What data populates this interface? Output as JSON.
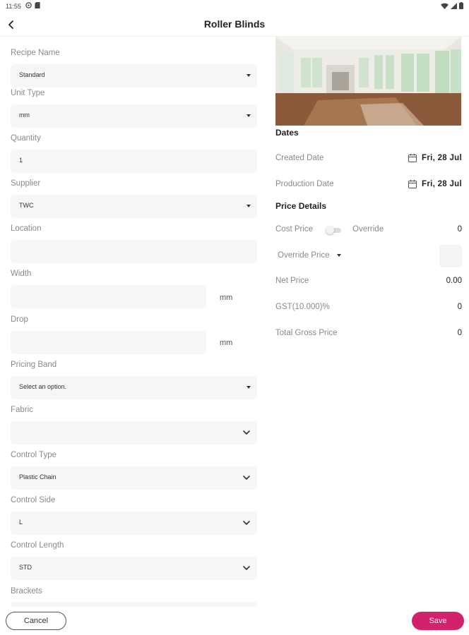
{
  "status_bar": {
    "time": "11:55",
    "icons": [
      "sync-icon",
      "sd-card-icon",
      "wifi-icon",
      "signal-icon",
      "battery-icon"
    ]
  },
  "app_bar": {
    "title": "Roller Blinds",
    "back_icon": "chevron-left-icon"
  },
  "form": {
    "recipe_name": {
      "label": "Recipe Name",
      "value": "Standard"
    },
    "unit_type": {
      "label": "Unit Type",
      "value": "mm"
    },
    "quantity": {
      "label": "Quantity",
      "value": "1"
    },
    "supplier": {
      "label": "Supplier",
      "value": "TWC"
    },
    "location": {
      "label": "Location",
      "value": ""
    },
    "width": {
      "label": "Width",
      "value": "",
      "unit": "mm"
    },
    "drop": {
      "label": "Drop",
      "value": "",
      "unit": "mm"
    },
    "pricing_band": {
      "label": "Pricing Band",
      "value": "Select an option."
    },
    "fabric": {
      "label": "Fabric",
      "value": ""
    },
    "control_type": {
      "label": "Control Type",
      "value": "Plastic Chain"
    },
    "control_side": {
      "label": "Control Side",
      "value": "L"
    },
    "control_length": {
      "label": "Control Length",
      "value": "STD"
    },
    "brackets": {
      "label": "Brackets",
      "value": ""
    }
  },
  "dates": {
    "title": "Dates",
    "created": {
      "label": "Created Date",
      "value": "Fri, 28 Jul"
    },
    "production": {
      "label": "Production Date",
      "value": "Fri, 28 Jul"
    }
  },
  "price_details": {
    "title": "Price Details",
    "cost_price_label": "Cost Price",
    "override_toggle_on": false,
    "override_label": "Override",
    "cost_price_value": "0",
    "override_price_label": "Override Price",
    "net_price": {
      "label": "Net Price",
      "value": "0.00"
    },
    "gst": {
      "label": "GST(10.000)%",
      "value": "0"
    },
    "total_gross": {
      "label": "Total Gross Price",
      "value": "0"
    }
  },
  "actions": {
    "cancel": "Cancel",
    "save": "Save"
  },
  "colors": {
    "accent": "#d1226b",
    "field_bg": "#f6f6f6",
    "label": "#8a8a8a"
  }
}
